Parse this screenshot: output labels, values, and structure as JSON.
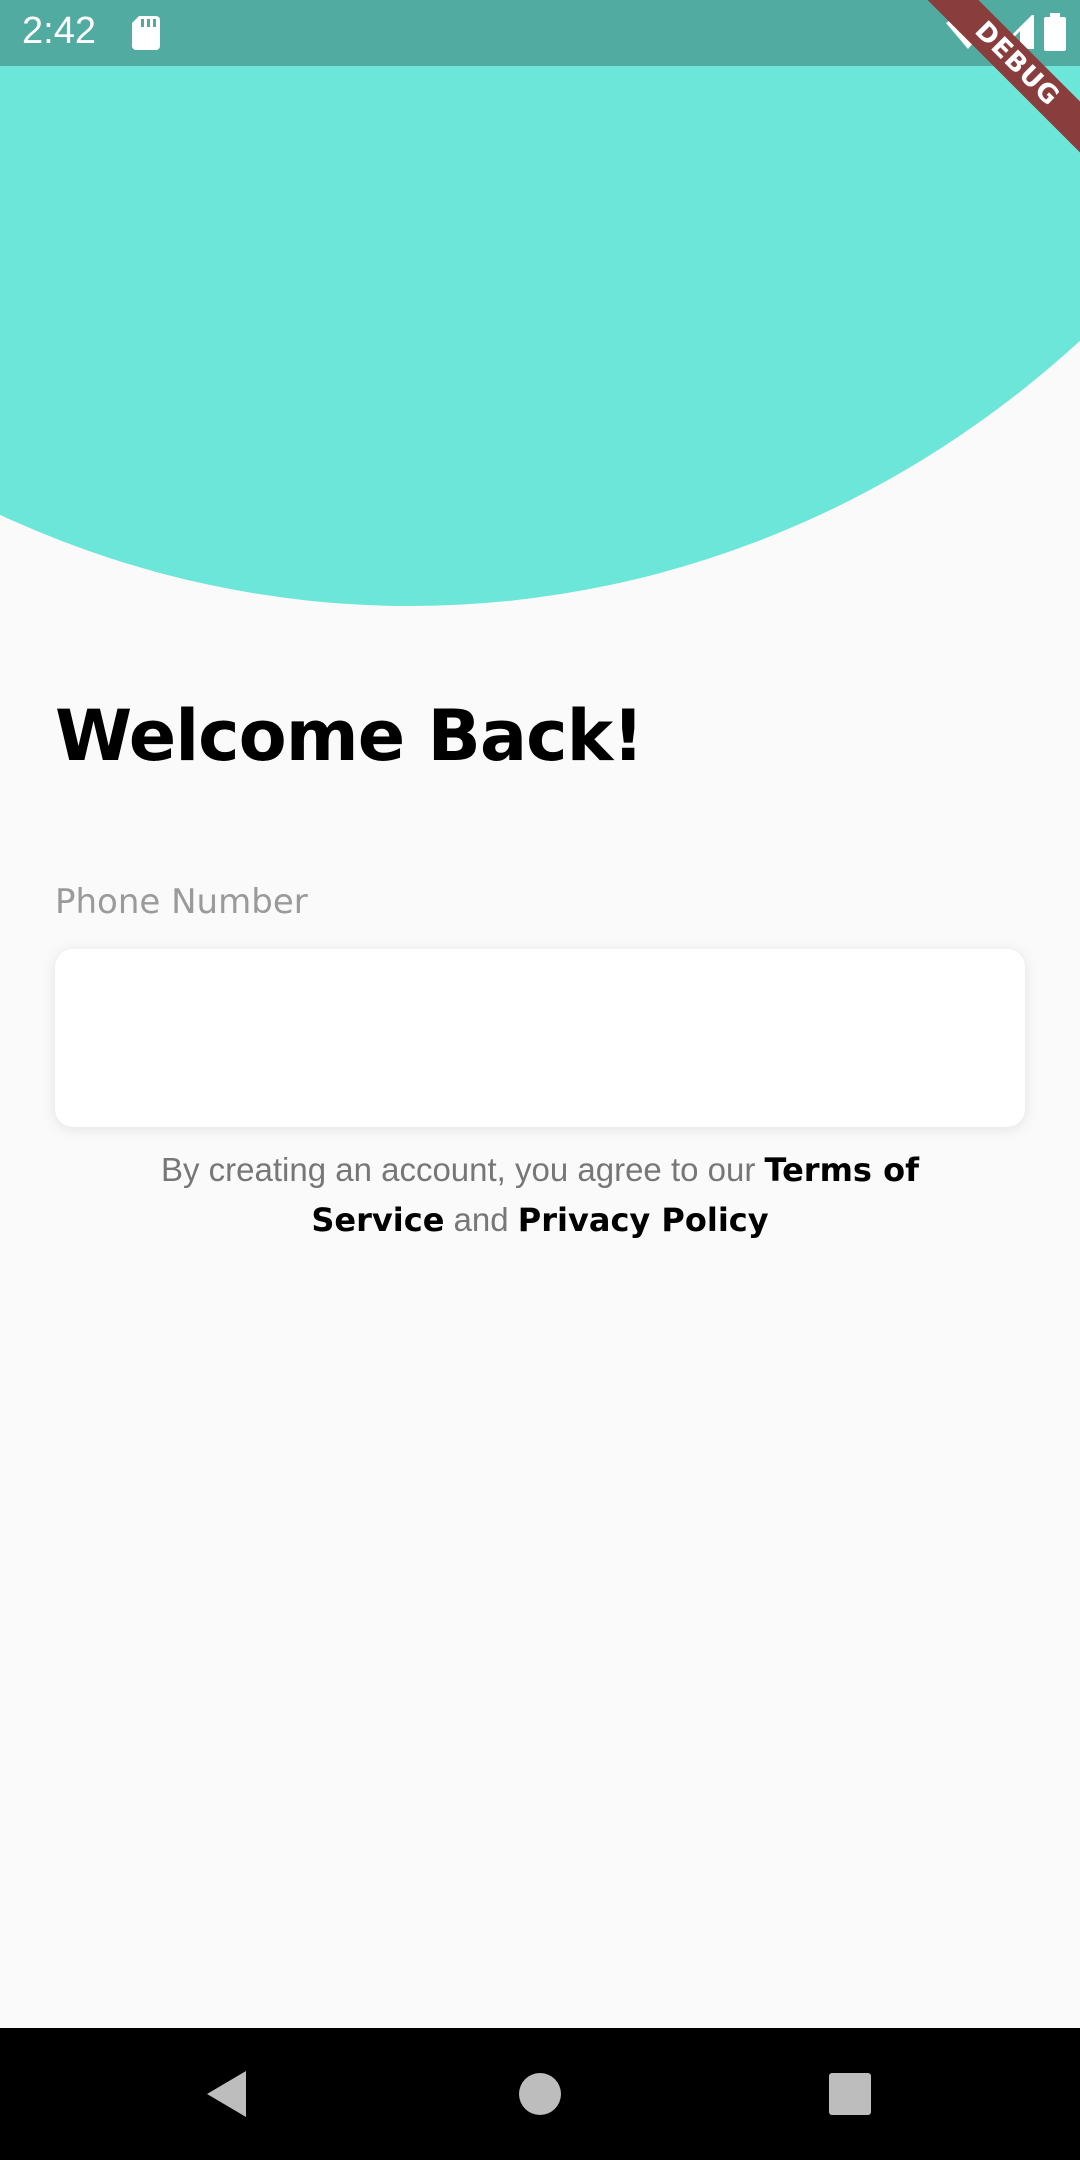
{
  "status_bar": {
    "time": "2:42",
    "icons": [
      "sd-card-icon",
      "wifi-icon",
      "cell-signal-icon",
      "battery-icon"
    ]
  },
  "debug_banner": {
    "label": "DEBUG"
  },
  "login": {
    "title": "Welcome Back!",
    "phone_label": "Phone Number",
    "phone_value": "",
    "terms_prefix": "By creating an account, you agree to our ",
    "terms_link": "Terms of Service",
    "terms_and": " and ",
    "privacy_link": "Privacy Policy"
  },
  "navigation": {
    "icons": [
      "back-icon",
      "home-icon",
      "recents-icon"
    ]
  },
  "colors": {
    "accent": "#6ce6d8",
    "status_bar": "#52aba0",
    "debug_banner": "#8a3d3d",
    "background": "#fafafa"
  }
}
